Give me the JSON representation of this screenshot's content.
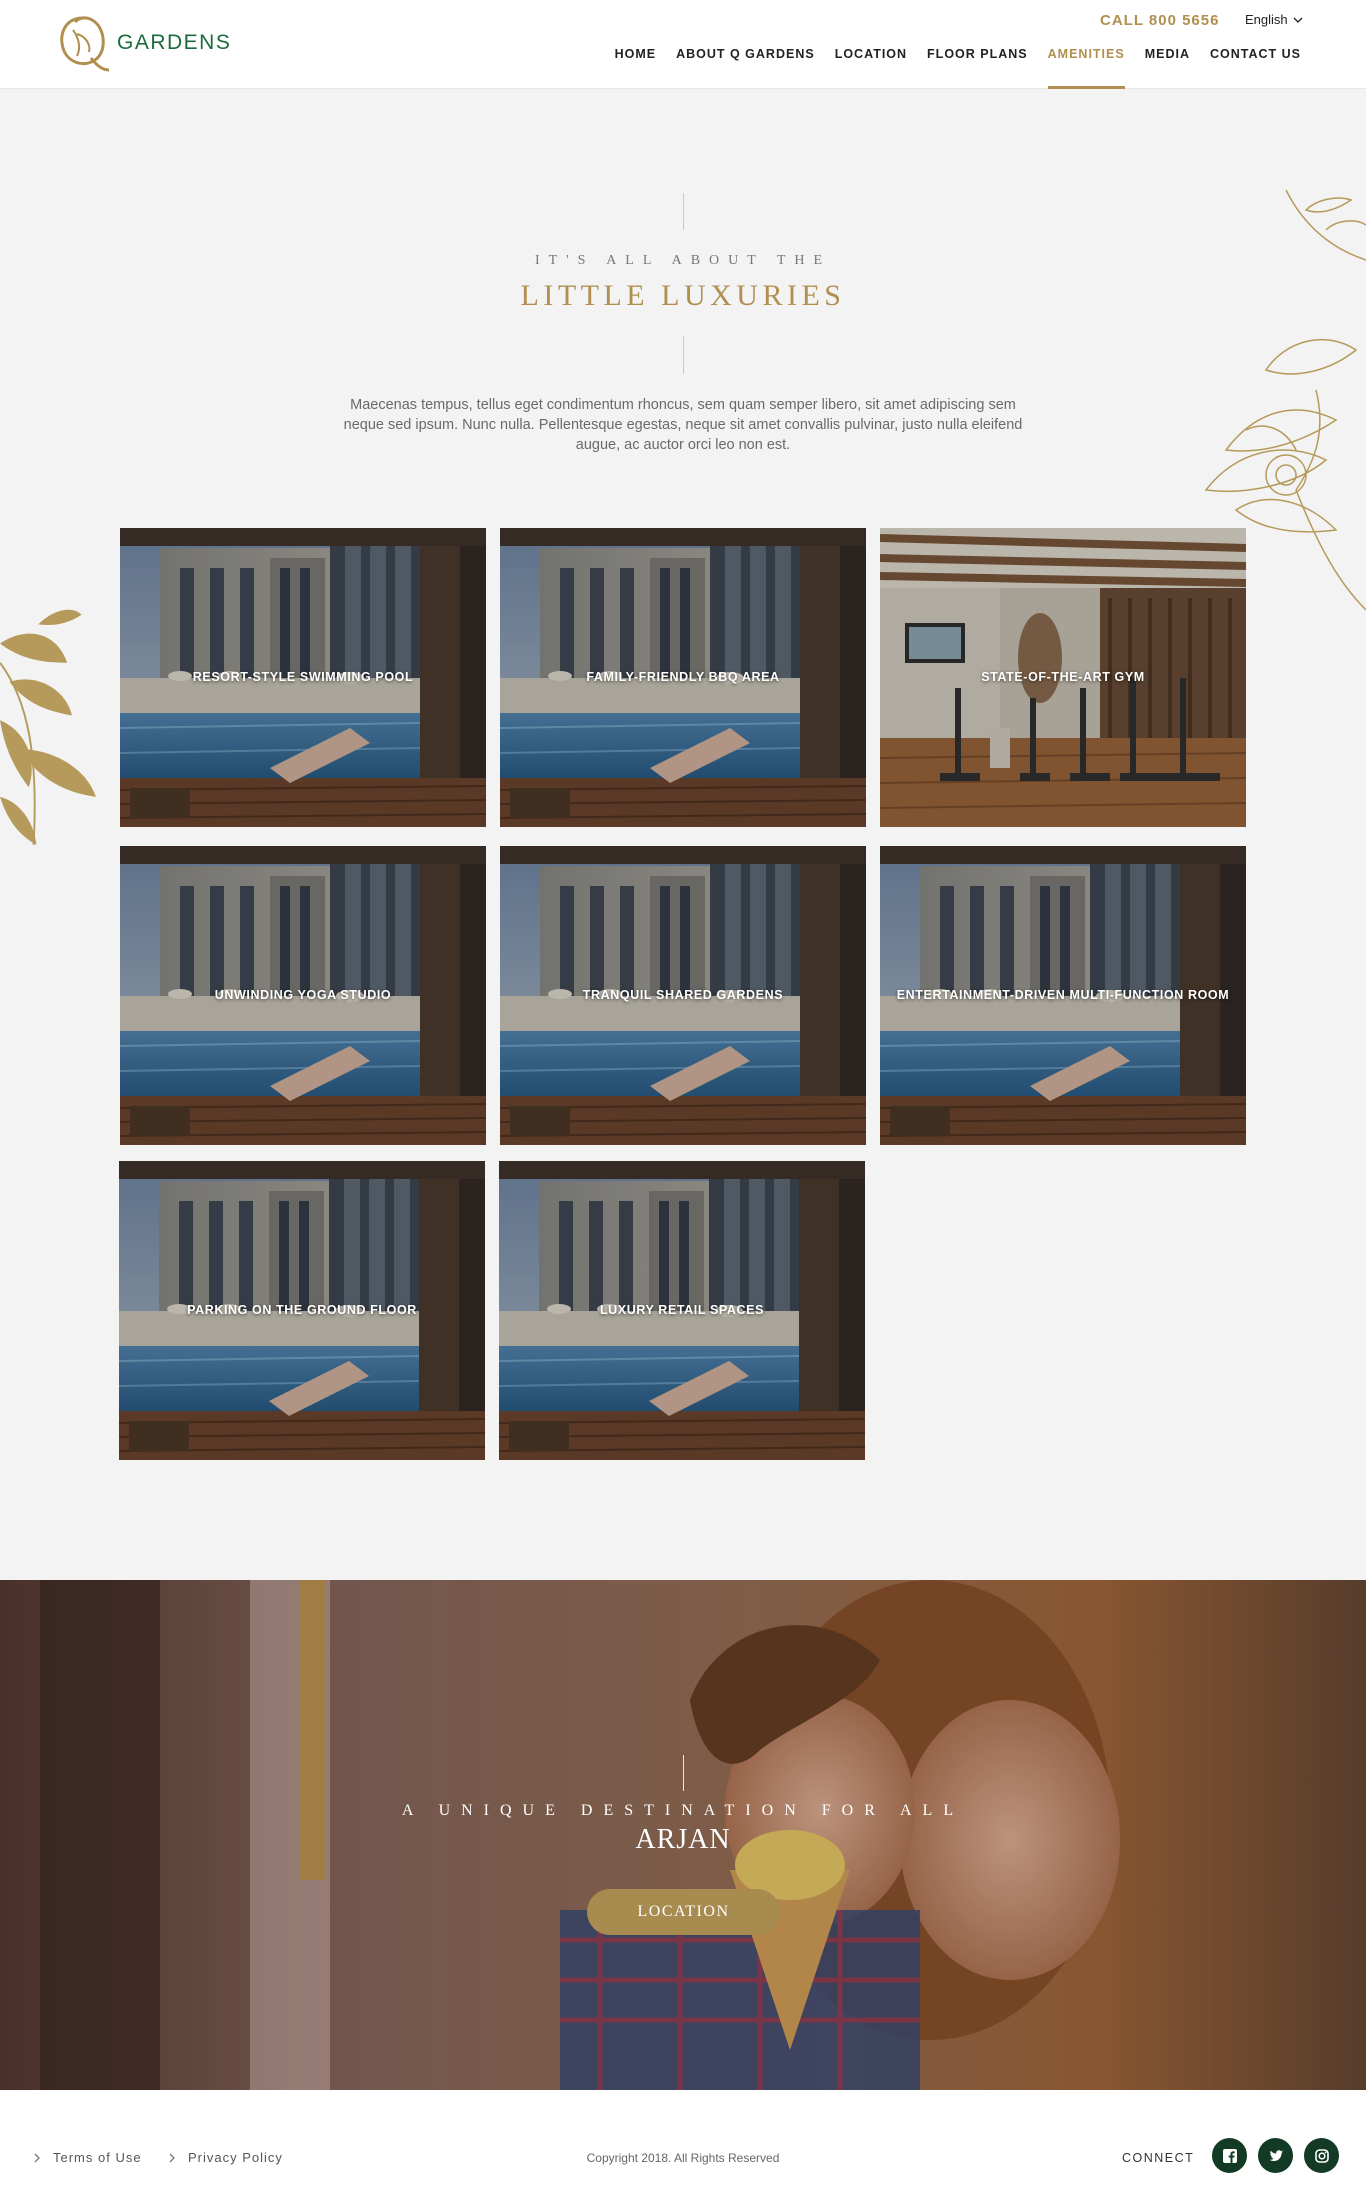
{
  "header": {
    "logo_text": "GARDENS",
    "call": "CALL 800 5656",
    "language": "English",
    "nav": [
      {
        "label": "HOME"
      },
      {
        "label": "ABOUT Q GARDENS"
      },
      {
        "label": "LOCATION"
      },
      {
        "label": "FLOOR PLANS"
      },
      {
        "label": "AMENITIES",
        "active": true
      },
      {
        "label": "MEDIA"
      },
      {
        "label": "CONTACT US"
      }
    ]
  },
  "intro": {
    "eyebrow": "IT'S ALL ABOUT THE",
    "title": "LITTLE LUXURIES",
    "body": "Maecenas tempus, tellus eget condimentum rhoncus, sem quam semper libero, sit amet adipiscing sem neque sed ipsum. Nunc nulla. Pellentesque egestas, neque sit amet convallis pulvinar, justo nulla eleifend augue, ac auctor orci leo non est."
  },
  "amenities": [
    {
      "label": "RESORT-STYLE SWIMMING POOL"
    },
    {
      "label": "FAMILY-FRIENDLY BBQ AREA"
    },
    {
      "label": "STATE-OF-THE-ART GYM"
    },
    {
      "label": "UNWINDING YOGA STUDIO"
    },
    {
      "label": "TRANQUIL SHARED GARDENS"
    },
    {
      "label": "ENTERTAINMENT-DRIVEN MULTI-FUNCTION ROOM"
    },
    {
      "label": "PARKING ON THE GROUND FLOOR"
    },
    {
      "label": "LUXURY RETAIL SPACES"
    }
  ],
  "banner": {
    "subtitle": "A UNIQUE DESTINATION FOR ALL",
    "title": "ARJAN",
    "button": "LOCATION"
  },
  "footer": {
    "terms": "Terms of Use",
    "privacy": "Privacy Policy",
    "copyright": "Copyright 2018. All Rights Reserved",
    "connect": "CONNECT"
  },
  "colors": {
    "accent_gold": "#b08f4f",
    "brand_green": "#1c6b3b",
    "social_bg": "#123a24",
    "button_gold": "#a88b4f"
  }
}
